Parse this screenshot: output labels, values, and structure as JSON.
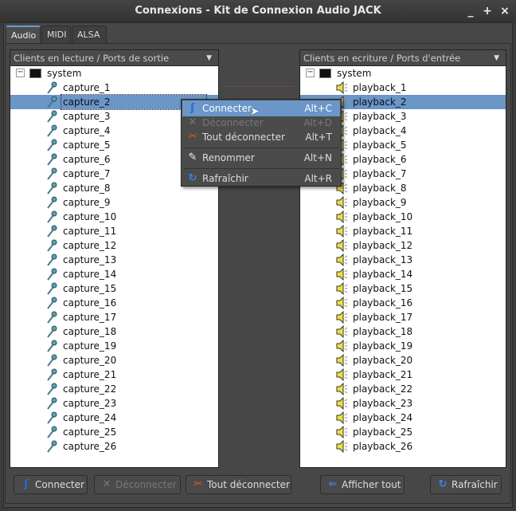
{
  "window": {
    "title": "Connexions - Kit de Connexion Audio JACK",
    "controls": [
      "_",
      "+",
      "×"
    ]
  },
  "tabs": [
    {
      "label": "Audio"
    },
    {
      "label": "MIDI"
    },
    {
      "label": "ALSA"
    }
  ],
  "left_list": {
    "header": "Clients en lecture / Ports de sortie",
    "client": "system",
    "selected_index": 1,
    "ports": [
      "capture_1",
      "capture_2",
      "capture_3",
      "capture_4",
      "capture_5",
      "capture_6",
      "capture_7",
      "capture_8",
      "capture_9",
      "capture_10",
      "capture_11",
      "capture_12",
      "capture_13",
      "capture_14",
      "capture_15",
      "capture_16",
      "capture_17",
      "capture_18",
      "capture_19",
      "capture_20",
      "capture_21",
      "capture_22",
      "capture_23",
      "capture_24",
      "capture_25",
      "capture_26"
    ]
  },
  "right_list": {
    "header": "Clients en ecriture / Ports d'entrée",
    "client": "system",
    "selected_index": 1,
    "ports": [
      "playback_1",
      "playback_2",
      "playback_3",
      "playback_4",
      "playback_5",
      "playback_6",
      "playback_7",
      "playback_8",
      "playback_9",
      "playback_10",
      "playback_11",
      "playback_12",
      "playback_13",
      "playback_14",
      "playback_15",
      "playback_16",
      "playback_17",
      "playback_18",
      "playback_19",
      "playback_20",
      "playback_21",
      "playback_22",
      "playback_23",
      "playback_24",
      "playback_25",
      "playback_26"
    ]
  },
  "context_menu": [
    {
      "label": "Connecter",
      "shortcut": "Alt+C",
      "icon": "connect-icon",
      "state": "highlighted"
    },
    {
      "label": "Déconnecter",
      "shortcut": "Alt+D",
      "icon": "disconnect-icon",
      "state": "disabled"
    },
    {
      "label": "Tout déconnecter",
      "shortcut": "Alt+T",
      "icon": "disconnect-all-icon",
      "state": "normal"
    },
    {
      "label": "Renommer",
      "shortcut": "Alt+N",
      "icon": "rename-icon",
      "state": "normal"
    },
    {
      "label": "Rafraîchir",
      "shortcut": "Alt+R",
      "icon": "refresh-icon",
      "state": "normal"
    }
  ],
  "buttons": {
    "connect": "Connecter",
    "disconnect": "Déconnecter",
    "disconnect_all": "Tout déconnecter",
    "show_all": "Afficher tout",
    "refresh": "Rafraîchir"
  },
  "colors": {
    "selection": "#6a96c8",
    "connect": "#2a6ad8",
    "disconnect_all": "#e05a20"
  }
}
